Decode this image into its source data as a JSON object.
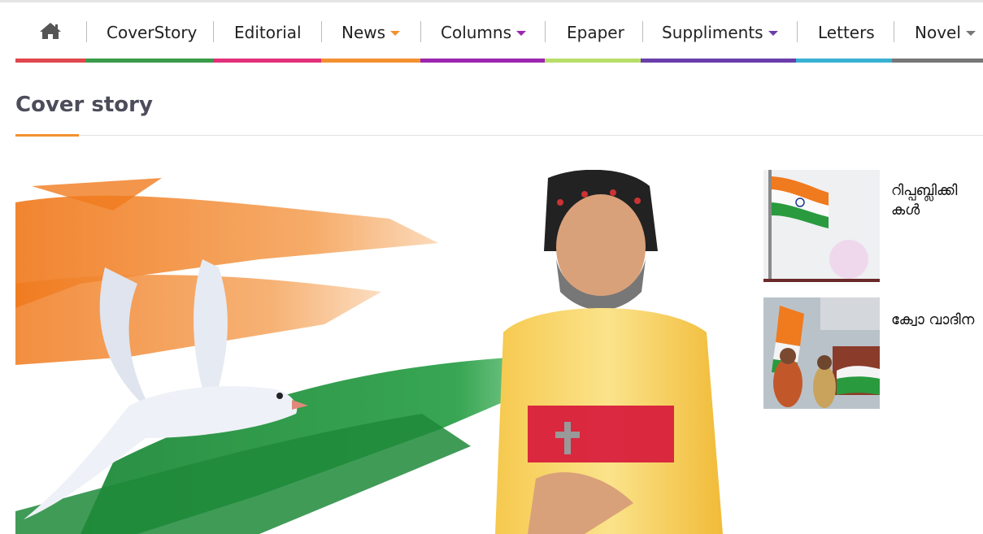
{
  "nav": {
    "home_icon": "home-icon",
    "items": [
      {
        "label": "CoverStory",
        "has_dropdown": false
      },
      {
        "label": "Editorial",
        "has_dropdown": false
      },
      {
        "label": "News",
        "has_dropdown": true,
        "caret_color": "#f39131"
      },
      {
        "label": "Columns",
        "has_dropdown": true,
        "caret_color": "#9b27b0"
      },
      {
        "label": "Epaper",
        "has_dropdown": false
      },
      {
        "label": "Suppliments",
        "has_dropdown": true,
        "caret_color": "#6a3eaa"
      },
      {
        "label": "Letters",
        "has_dropdown": false
      },
      {
        "label": "Novel",
        "has_dropdown": true,
        "caret_color": "#777777"
      }
    ],
    "bar_colors": [
      "#e0474c",
      "#3a9b4a",
      "#e2307a",
      "#f39131",
      "#9b27b0",
      "#b6df6a",
      "#6a3eaa",
      "#39b1d2",
      "#777777"
    ]
  },
  "section": {
    "title": "Cover story",
    "accent_color": "#f39131"
  },
  "hero": {
    "image": "hero-dove-flag-bishop-image"
  },
  "side_list": [
    {
      "title_line1": "റിപ്പബ്ലിക്കി",
      "title_line2": "കൾ",
      "thumb": "indian-flag-thumb"
    },
    {
      "title_line1": "ക്വോ വാദിന",
      "title_line2": "",
      "thumb": "crowd-flags-thumb"
    }
  ]
}
